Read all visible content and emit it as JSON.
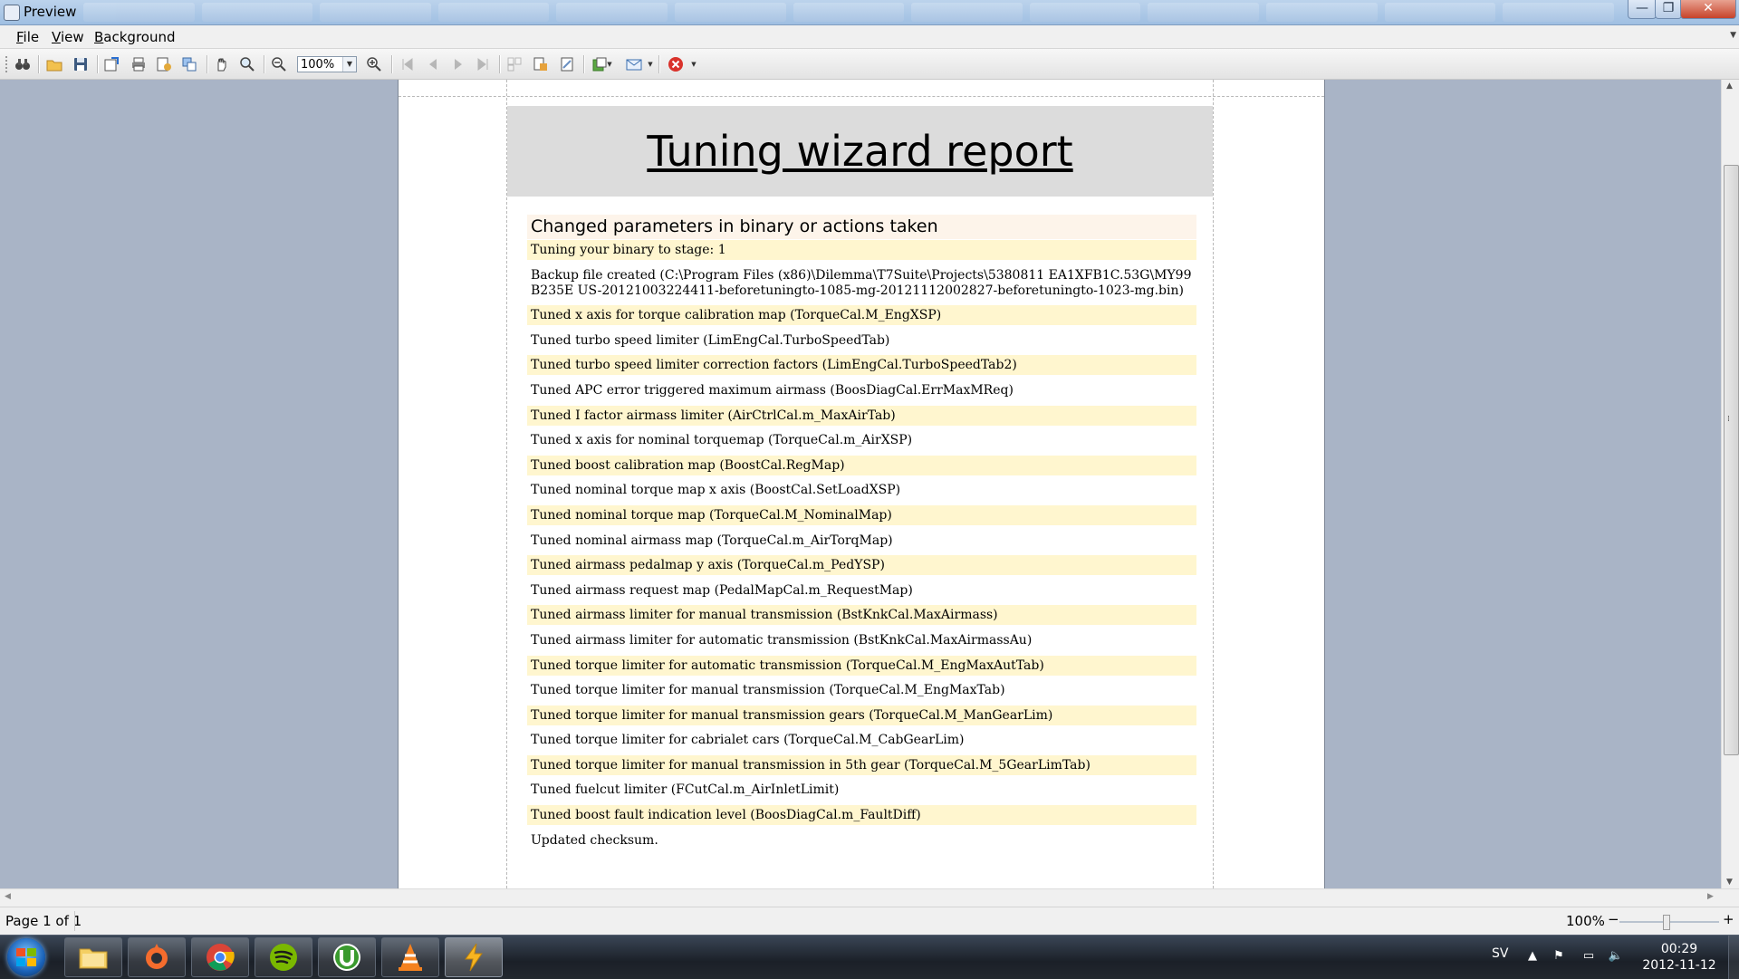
{
  "window": {
    "title": "Preview",
    "buttons": {
      "minimize": "—",
      "maximize": "❐",
      "close": "✕"
    }
  },
  "menu": {
    "items": [
      {
        "label": "File",
        "accel": "F",
        "rest": "ile"
      },
      {
        "label": "View",
        "accel": "V",
        "rest": "iew"
      },
      {
        "label": "Background",
        "accel": "B",
        "rest": "ackground"
      }
    ]
  },
  "toolbar": {
    "zoom_value": "100%",
    "icons": [
      "find-icon",
      "open-icon",
      "save-icon",
      "export-icon",
      "print-icon",
      "page-setup-icon",
      "scale-icon",
      "hand-tool-icon",
      "magnifier-icon",
      "zoom-out-icon",
      "zoom-in-icon",
      "first-page-icon",
      "prev-page-icon",
      "next-page-icon",
      "last-page-icon",
      "multiple-pages-icon",
      "header-footer-icon",
      "watermark-icon",
      "export-document-icon",
      "send-email-icon",
      "close-preview-icon"
    ]
  },
  "report": {
    "title": "Tuning wizard report",
    "section_title": "Changed parameters in binary or actions taken",
    "lines": [
      {
        "text": "Tuning your binary to stage: 1",
        "highlight": true
      },
      {
        "text": "Backup file created (C:\\Program Files (x86)\\Dilemma\\T7Suite\\Projects\\5380811 EA1XFB1C.53G\\MY99",
        "text2": "B235E US-20121003224411-beforetuningto-1085-mg-20121112002827-beforetuningto-1023-mg.bin)",
        "highlight": false
      },
      {
        "text": "Tuned x axis for torque calibration map (TorqueCal.M_EngXSP)",
        "highlight": true
      },
      {
        "text": "Tuned turbo speed limiter (LimEngCal.TurboSpeedTab)",
        "highlight": false
      },
      {
        "text": "Tuned turbo speed limiter correction factors (LimEngCal.TurboSpeedTab2)",
        "highlight": true
      },
      {
        "text": "Tuned APC error triggered maximum airmass (BoosDiagCal.ErrMaxMReq)",
        "highlight": false
      },
      {
        "text": "Tuned I factor airmass limiter (AirCtrlCal.m_MaxAirTab)",
        "highlight": true
      },
      {
        "text": "Tuned x axis for nominal torquemap (TorqueCal.m_AirXSP)",
        "highlight": false
      },
      {
        "text": "Tuned boost calibration map (BoostCal.RegMap)",
        "highlight": true
      },
      {
        "text": "Tuned nominal torque map x axis (BoostCal.SetLoadXSP)",
        "highlight": false
      },
      {
        "text": "Tuned nominal torque map (TorqueCal.M_NominalMap)",
        "highlight": true
      },
      {
        "text": "Tuned nominal airmass map (TorqueCal.m_AirTorqMap)",
        "highlight": false
      },
      {
        "text": "Tuned airmass pedalmap y axis (TorqueCal.m_PedYSP)",
        "highlight": true
      },
      {
        "text": "Tuned airmass request map (PedalMapCal.m_RequestMap)",
        "highlight": false
      },
      {
        "text": "Tuned airmass limiter for manual transmission (BstKnkCal.MaxAirmass)",
        "highlight": true
      },
      {
        "text": "Tuned airmass limiter for automatic transmission (BstKnkCal.MaxAirmassAu)",
        "highlight": false
      },
      {
        "text": "Tuned torque limiter for automatic transmission (TorqueCal.M_EngMaxAutTab)",
        "highlight": true
      },
      {
        "text": "Tuned torque limiter for manual transmission (TorqueCal.M_EngMaxTab)",
        "highlight": false
      },
      {
        "text": "Tuned torque limiter for manual transmission gears (TorqueCal.M_ManGearLim)",
        "highlight": true
      },
      {
        "text": "Tuned torque limiter for cabrialet cars (TorqueCal.M_CabGearLim)",
        "highlight": false
      },
      {
        "text": "Tuned torque limiter for manual transmission in 5th gear (TorqueCal.M_5GearLimTab)",
        "highlight": true
      },
      {
        "text": "Tuned fuelcut limiter (FCutCal.m_AirInletLimit)",
        "highlight": false
      },
      {
        "text": "Tuned boost fault indication level (BoosDiagCal.m_FaultDiff)",
        "highlight": true
      },
      {
        "text": "Updated checksum.",
        "highlight": false
      }
    ]
  },
  "statusbar": {
    "page_info": "Page 1 of 1",
    "zoom": "100%",
    "zoom_level_percent": 100
  },
  "taskbar": {
    "apps": [
      "file-explorer",
      "origin",
      "chrome",
      "spotify",
      "utorrent",
      "vlc",
      "t7suite"
    ],
    "language": "SV",
    "time": "00:29",
    "date": "2012-11-12"
  }
}
